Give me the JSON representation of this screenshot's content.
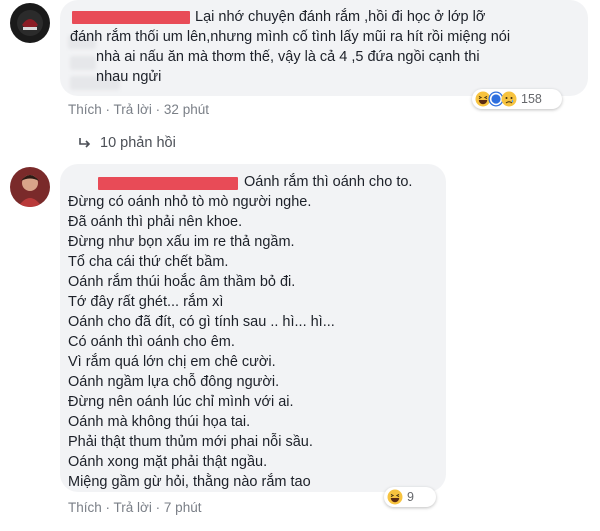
{
  "comment1": {
    "lines": [
      "Lại nhớ chuyện đánh rắm ,hồi đi học ở lớp lỡ",
      "đánh rắm thối um lên,nhưng mình cố tình lấy mũi ra hít rồi miệng nói",
      "nhà ai nấu ăn mà thơm thế, vậy là cả 4 ,5 đứa ngồi cạnh thi",
      "nhau ngửi"
    ],
    "like": "Thích",
    "reply": "Trả lời",
    "time": "32 phút",
    "reaction_count": "158",
    "reactions": [
      "haha-icon",
      "wow-icon",
      "sad-icon"
    ]
  },
  "replies_toggle": {
    "label": "10 phản hồi"
  },
  "comment2": {
    "lines": [
      "Oánh rắm thì oánh cho to.",
      "Đừng có oánh nhỏ tò mò người nghe.",
      "Đã oánh thì phải nên khoe.",
      "Đừng như bọn xấu im re thả ngầm.",
      "Tổ cha cái thứ chết bầm.",
      "Oánh rắm thúi hoắc âm thầm bỏ đi.",
      "Tớ đây rất ghét... rắm xì",
      "Oánh cho đã đít, có gì tính sau .. hì... hì...",
      "Có oánh thì oánh cho êm.",
      "Vì rắm quá lớn chị em chê cười.",
      "Oánh ngầm lựa chỗ đông người.",
      "Đừng nên oánh lúc chỉ mình với ai.",
      "Oánh mà không thúi họa tai.",
      "Phải thật thum thủm mới phai nỗi sầu.",
      "Oánh xong mặt phải thật ngầu.",
      "Miệng gầm gừ hỏi, thằng nào rắm tao"
    ],
    "like": "Thích",
    "reply": "Trả lời",
    "time": "7 phút",
    "reaction_count": "9",
    "reactions": [
      "haha-icon"
    ]
  },
  "colors": {
    "bubble": "#f2f3f5",
    "redaction": "#e84b57",
    "meta_text": "#7a7f87",
    "haha": "#f7c33f"
  }
}
